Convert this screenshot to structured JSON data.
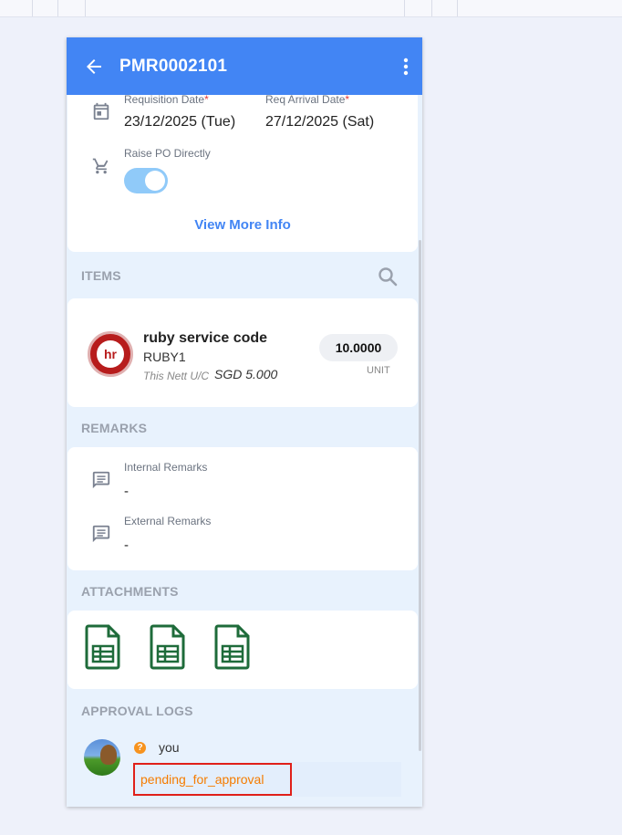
{
  "header": {
    "title": "PMR0002101"
  },
  "details": {
    "requisition_date_label": "Requisition Date",
    "requisition_date_value": "23/12/2025 (Tue)",
    "req_arrival_date_label": "Req Arrival Date",
    "req_arrival_date_value": "27/12/2025 (Sat)",
    "required_marker": "*",
    "raise_po_label": "Raise PO Directly",
    "raise_po_enabled": true,
    "view_more_label": "View More Info"
  },
  "items": {
    "section_title": "ITEMS",
    "list": [
      {
        "name": "ruby service code",
        "code": "RUBY1",
        "price_label": "This Nett U/C",
        "price_value": "SGD 5.000",
        "quantity": "10.0000",
        "unit": "UNIT",
        "logo_text": "hr"
      }
    ]
  },
  "remarks": {
    "section_title": "REMARKS",
    "internal_label": "Internal Remarks",
    "internal_value": "-",
    "external_label": "External Remarks",
    "external_value": "-"
  },
  "attachments": {
    "section_title": "ATTACHMENTS",
    "files": [
      {
        "icon": "spreadsheet-file-icon"
      },
      {
        "icon": "spreadsheet-file-icon"
      },
      {
        "icon": "spreadsheet-file-icon"
      }
    ]
  },
  "approval_logs": {
    "section_title": "APPROVAL LOGS",
    "entries": [
      {
        "user": "you",
        "badge": "?",
        "status": "pending_for_approval"
      }
    ]
  },
  "colors": {
    "primary": "#4285f4",
    "status_pending": "#f57c00",
    "attachment_icon": "#1e6b3a",
    "highlight_outline": "#e0201a"
  }
}
